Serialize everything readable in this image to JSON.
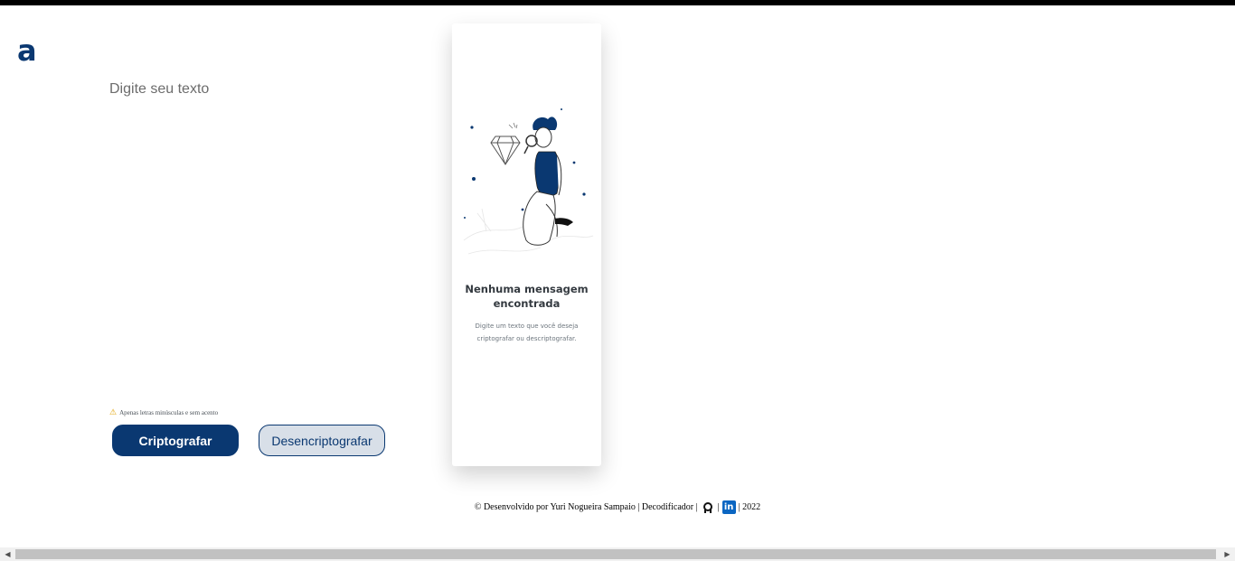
{
  "logo": {
    "glyph": "a",
    "color": "#0a3871"
  },
  "input": {
    "placeholder": "Digite seu texto",
    "value": ""
  },
  "warning": {
    "icon": "warning-icon",
    "text": "Apenas letras minúsculas e sem acento"
  },
  "buttons": {
    "encrypt": "Criptografar",
    "decrypt": "Desencriptografar"
  },
  "output_panel": {
    "title": "Nenhuma mensagem encontrada",
    "subtitle": "Digite um texto que você deseja criptografar ou descriptografar."
  },
  "footer": {
    "credit": "© Desenvolvido por Yuri Nogueira Sampaio | Decodificador |",
    "github_icon": "github-icon",
    "separator": "|",
    "linkedin_icon": "linkedin-icon",
    "linkedin_text": "in",
    "year": "| 2022"
  },
  "colors": {
    "accent": "#0a3871",
    "secondary_button_bg": "#d8dfe8"
  }
}
